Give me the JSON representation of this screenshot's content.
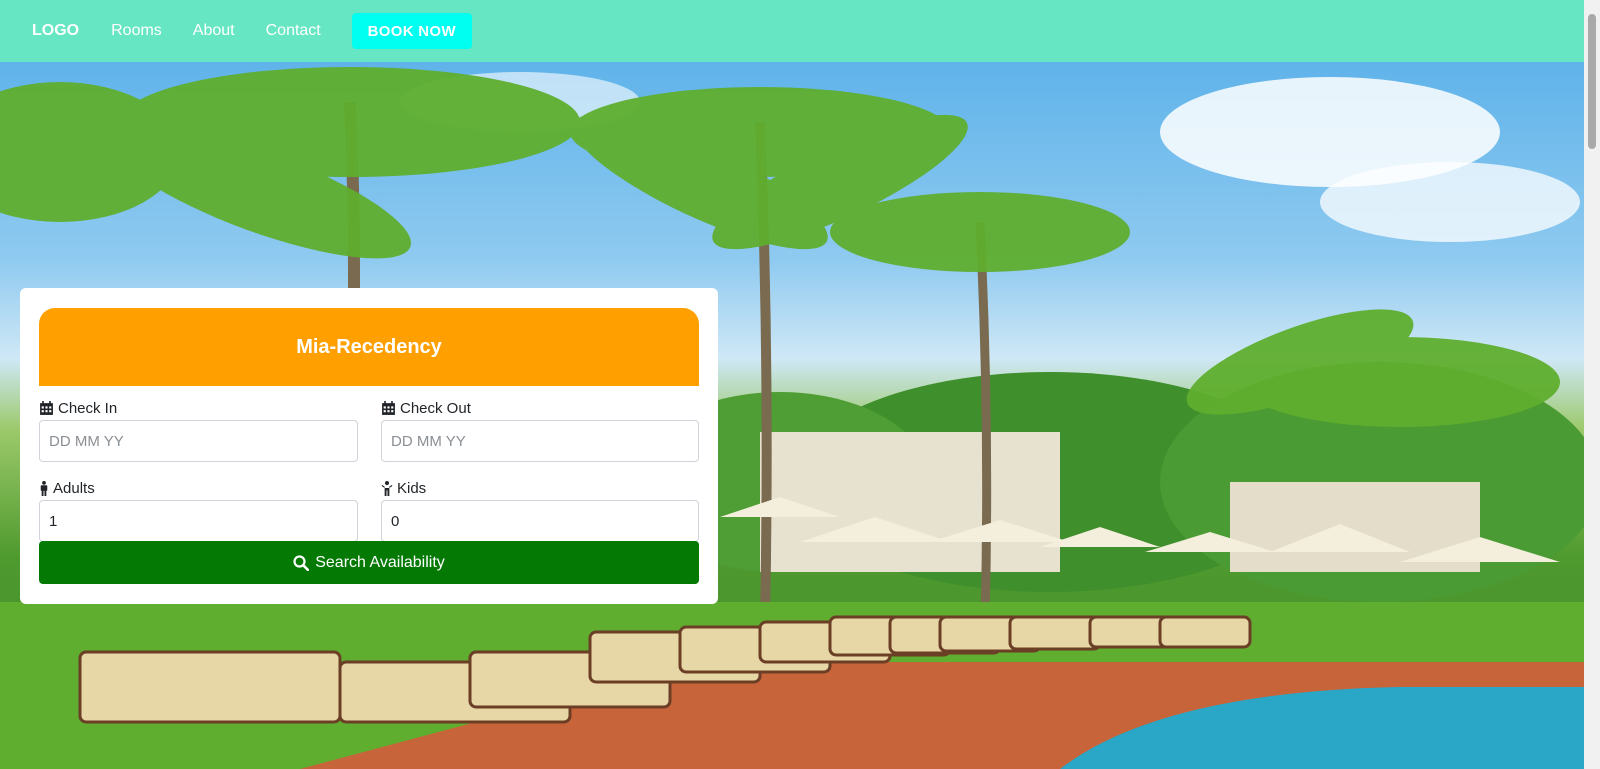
{
  "nav": {
    "logo": "LOGO",
    "links": [
      "Rooms",
      "About",
      "Contact"
    ],
    "book_button": "BOOK NOW"
  },
  "booking": {
    "title": "Mia-Recedency",
    "check_in": {
      "label": "Check In",
      "placeholder": "DD MM YY",
      "icon": "calendar-icon"
    },
    "check_out": {
      "label": "Check Out",
      "placeholder": "DD MM YY",
      "icon": "calendar-icon"
    },
    "adults": {
      "label": "Adults",
      "value": "1",
      "icon": "male-person-icon"
    },
    "kids": {
      "label": "Kids",
      "value": "0",
      "icon": "child-icon"
    },
    "search_button": "Search Availability",
    "search_icon": "search-icon"
  },
  "colors": {
    "navbar": "#66e6c2",
    "book_button": "#00fff0",
    "card_header": "#ffa000",
    "search_button": "#047a04"
  }
}
